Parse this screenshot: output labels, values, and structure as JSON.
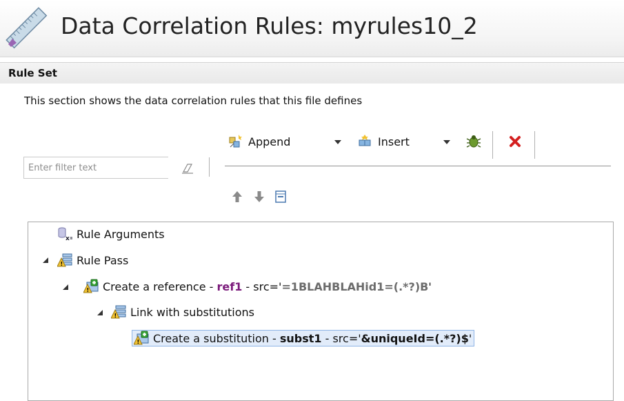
{
  "header": {
    "title": "Data Correlation Rules: myrules10_2",
    "icon": "ruler-pencil-icon"
  },
  "section": {
    "title": "Rule Set",
    "description": "This section shows the data correlation rules that this file defines"
  },
  "filter": {
    "placeholder": "Enter filter text",
    "value": ""
  },
  "toolbar": {
    "append_label": "Append",
    "insert_label": "Insert"
  },
  "tree": {
    "rule_arguments": "Rule Arguments",
    "rule_pass": "Rule Pass",
    "create_reference": {
      "prefix": "Create a reference - ",
      "name": "ref1",
      "mid": " - src='",
      "src": "=1BLAHBLAHid1=(.*?)B",
      "end": "'"
    },
    "link": "Link with substitutions",
    "create_substitution": {
      "prefix": "Create a substitution - ",
      "name": "subst1",
      "mid": " - src='",
      "src": "&uniqueId=(.*?)$",
      "end": "'"
    }
  },
  "colors": {
    "reference_name": "#7b1a7b",
    "selection_bg": "#e2ecfa",
    "delete_red": "#d42020"
  }
}
